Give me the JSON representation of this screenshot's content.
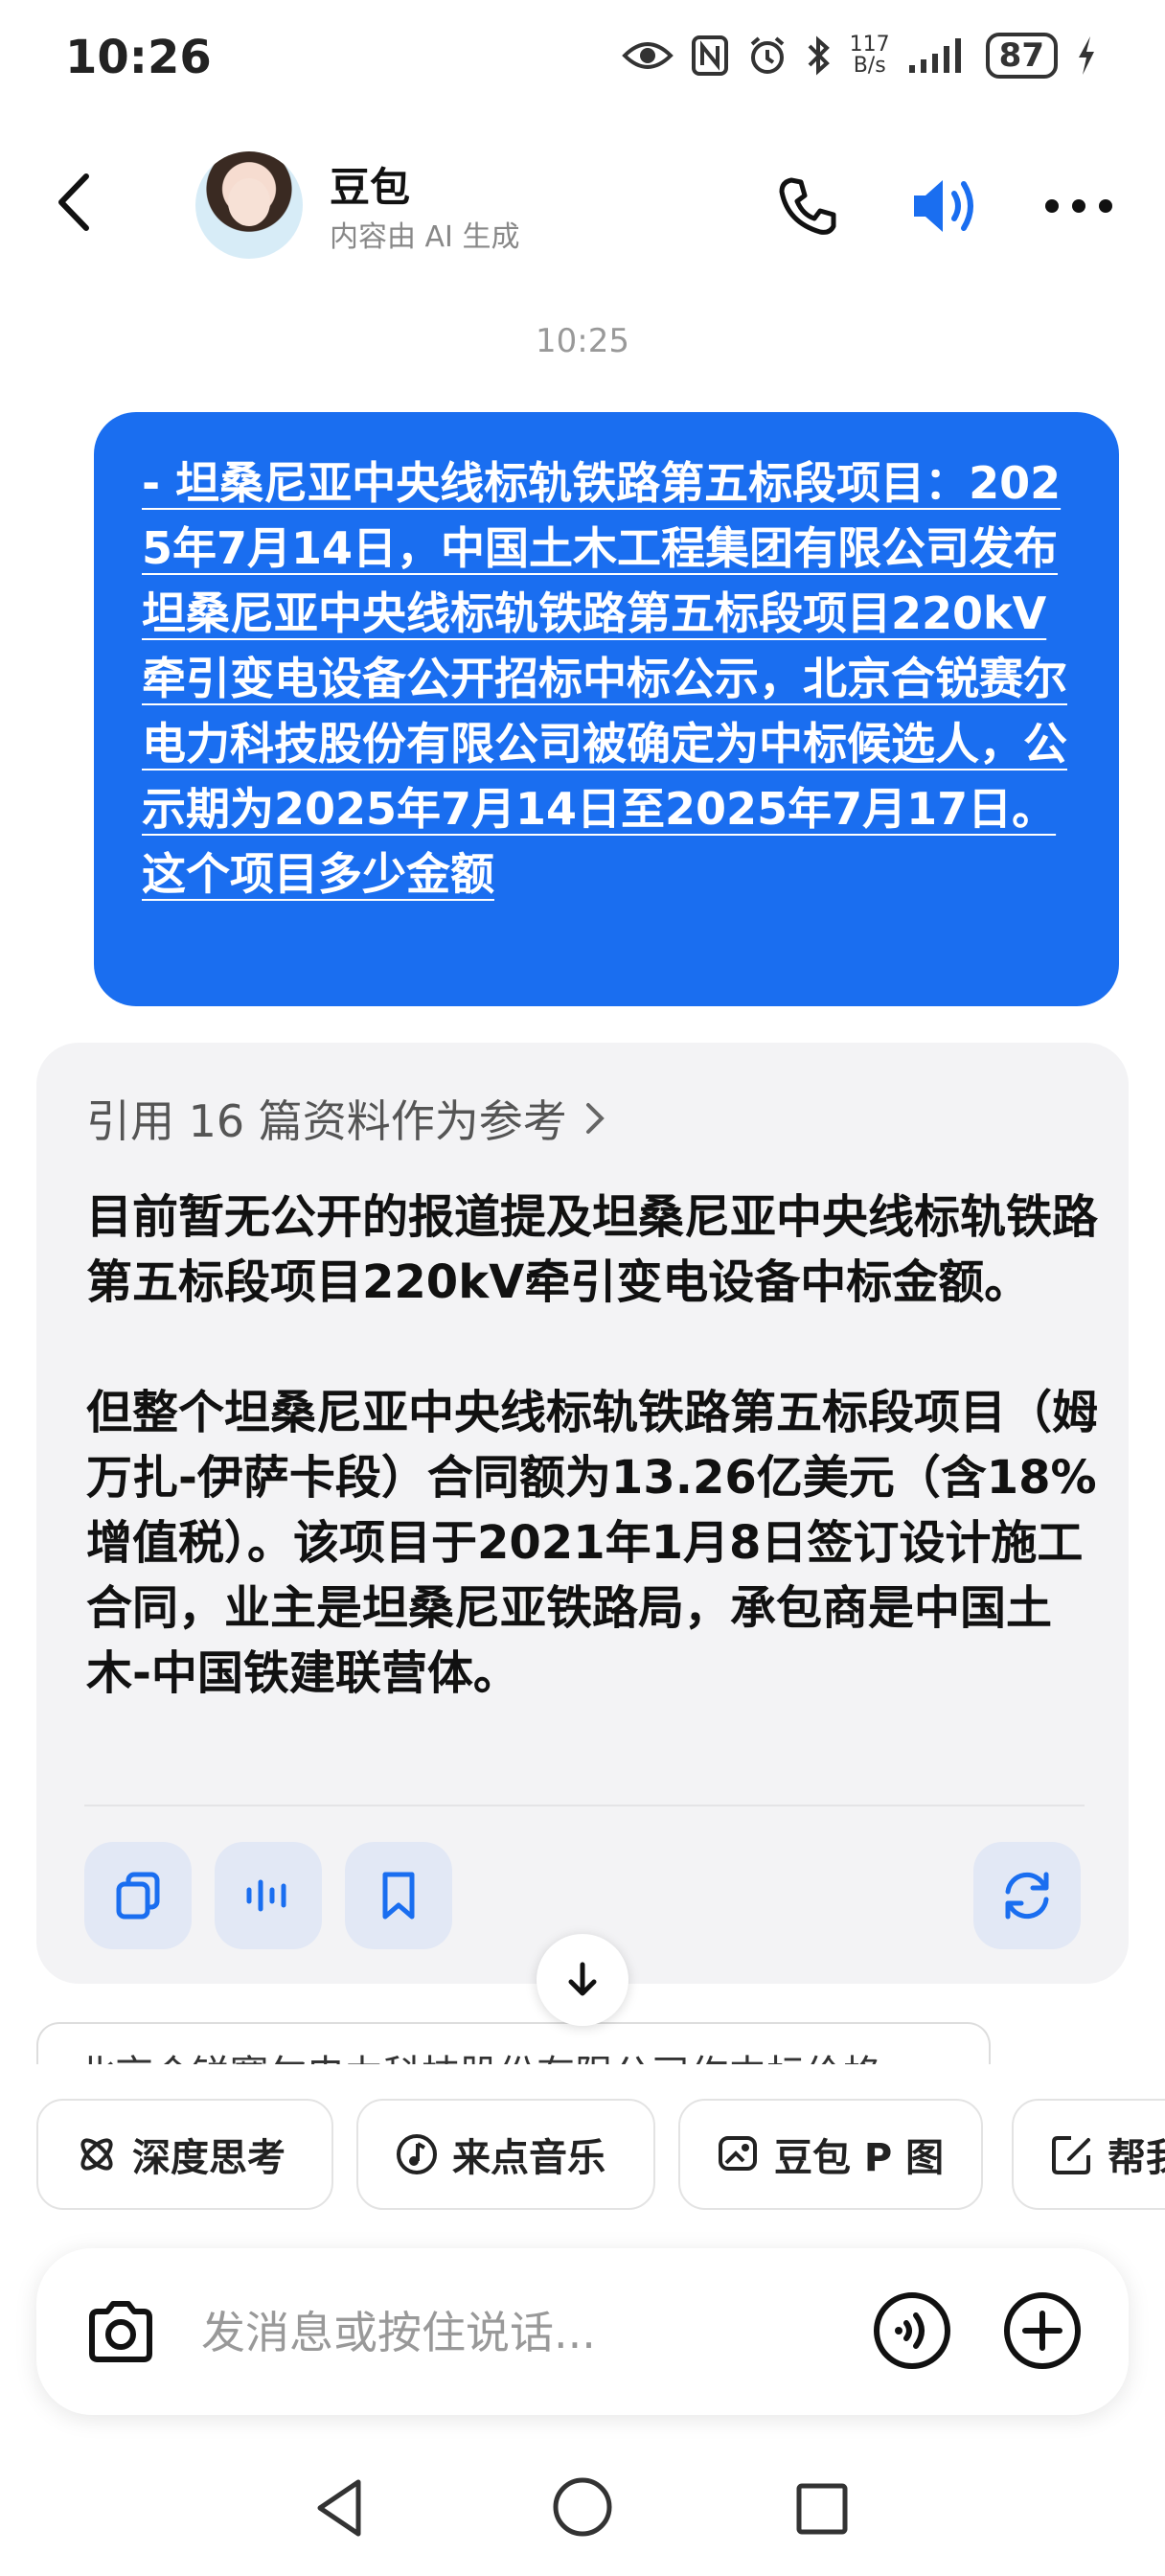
{
  "status_bar": {
    "time": "10:26",
    "net_speed_value": "117",
    "net_speed_unit": "B/s",
    "battery": "87",
    "icons": [
      "eye-icon",
      "nfc-icon",
      "alarm-icon",
      "bluetooth-icon",
      "signal-icon",
      "charging-icon"
    ]
  },
  "header": {
    "name": "豆包",
    "subtitle": "内容由 AI 生成",
    "accent_color": "#1a6ef0"
  },
  "chat": {
    "timestamp": "10:25",
    "user_message": "- 坦桑尼亚中央线标轨铁路第五标段项目：2025年7月14日，中国土木工程集团有限公司发布坦桑尼亚中央线标轨铁路第五标段项目220kV牵引变电设备公开招标中标公示，北京合锐赛尔电力科技股份有限公司被确定为中标候选人，公示期为2025年7月14日至2025年7月17日。这个项目多少金额",
    "ai_reply": {
      "references_label": "引用 16 篇资料作为参考",
      "paragraphs": [
        "目前暂无公开的报道提及坦桑尼亚中央线标轨铁路第五标段项目220kV牵引变电设备中标金额。",
        "但整个坦桑尼亚中央线标轨铁路第五标段项目（姆万扎-伊萨卡段）合同额为13.26亿美元（含18%增值税）。该项目于2021年1月8日签订设计施工合同，业主是坦桑尼亚铁路局，承包商是中国土木-中国铁建联营体。"
      ]
    },
    "suggestion_partial": "北京合锐赛尔电力科技股份有限公司作中标价格"
  },
  "chips": [
    {
      "label": "深度思考",
      "icon": "atom-icon"
    },
    {
      "label": "来点音乐",
      "icon": "music-note-icon"
    },
    {
      "label": "豆包 P 图",
      "icon": "image-edit-icon"
    },
    {
      "label": "帮我写作",
      "icon": "pen-square-icon"
    }
  ],
  "input": {
    "placeholder": "发消息或按住说话..."
  }
}
